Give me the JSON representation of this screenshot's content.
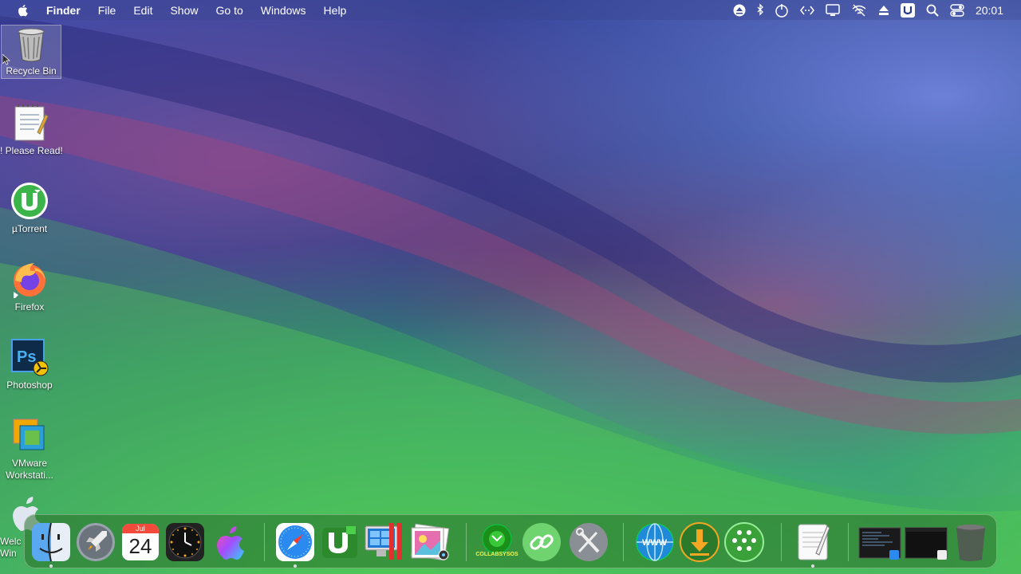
{
  "menubar": {
    "app": "Finder",
    "items": [
      "File",
      "Edit",
      "Show",
      "Go to",
      "Windows",
      "Help"
    ],
    "clock": "20:01",
    "status_icons": [
      "eject-icon",
      "bluetooth-icon",
      "power-icon",
      "code-icon",
      "display-icon",
      "wifi-off-icon",
      "eject-icon",
      "u-badge-icon",
      "search-icon",
      "control-center-icon"
    ]
  },
  "desktop": {
    "icons": [
      {
        "label": "Recycle Bin",
        "icon": "recycle-bin-icon"
      },
      {
        "label": "! Please Read!",
        "icon": "notepad-icon"
      },
      {
        "label": "µTorrent",
        "icon": "utorrent-icon"
      },
      {
        "label": "Firefox",
        "icon": "firefox-icon"
      },
      {
        "label": "Photoshop",
        "icon": "photoshop-icon"
      },
      {
        "label": "VMware Workstati...",
        "icon": "vmware-icon"
      },
      {
        "label": "Welc Win",
        "icon": "apple-welcome-icon"
      }
    ]
  },
  "dock": {
    "calendar": {
      "month": "Jul",
      "day": "24"
    },
    "items": [
      "finder",
      "launchpad",
      "calendar",
      "clock",
      "siri",
      "safari",
      "utorrent",
      "parallels",
      "photos",
      "collabsysos",
      "link",
      "utilities",
      "www",
      "downloads",
      "people",
      "textedit",
      "window-preview",
      "window-preview-2",
      "trash"
    ],
    "collab_label": "COLLABSYSOS",
    "colors": {
      "dock_bg": "#2e6e2e",
      "accent": "#3b82f6"
    }
  }
}
